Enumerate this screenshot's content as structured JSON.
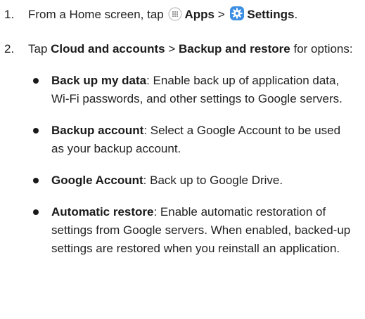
{
  "steps": [
    {
      "number": "1.",
      "prefix": "From a Home screen, tap",
      "apps_label": "Apps",
      "separator": ">",
      "settings_label": "Settings",
      "suffix": "."
    },
    {
      "number": "2.",
      "prefix": "Tap",
      "cloud_label": "Cloud and accounts",
      "separator": ">",
      "backup_label": "Backup and restore",
      "suffix": "for options:"
    }
  ],
  "options": [
    {
      "title": "Back up my data",
      "text": ": Enable back up of application data, Wi-Fi passwords, and other settings to Google servers."
    },
    {
      "title": "Backup account",
      "text": ": Select a Google Account to be used as your backup account."
    },
    {
      "title": "Google Account",
      "text": ": Back up to Google Drive."
    },
    {
      "title": "Automatic restore",
      "text": ": Enable automatic restoration of settings from Google servers. When enabled, backed-up settings are restored when you reinstall an application."
    }
  ],
  "icons": {
    "apps": "apps-grid-icon",
    "settings": "settings-gear-icon"
  },
  "colors": {
    "text": "#222222",
    "settings_icon": "#3d8fe3",
    "apps_icon_border": "#bdbdbd"
  }
}
